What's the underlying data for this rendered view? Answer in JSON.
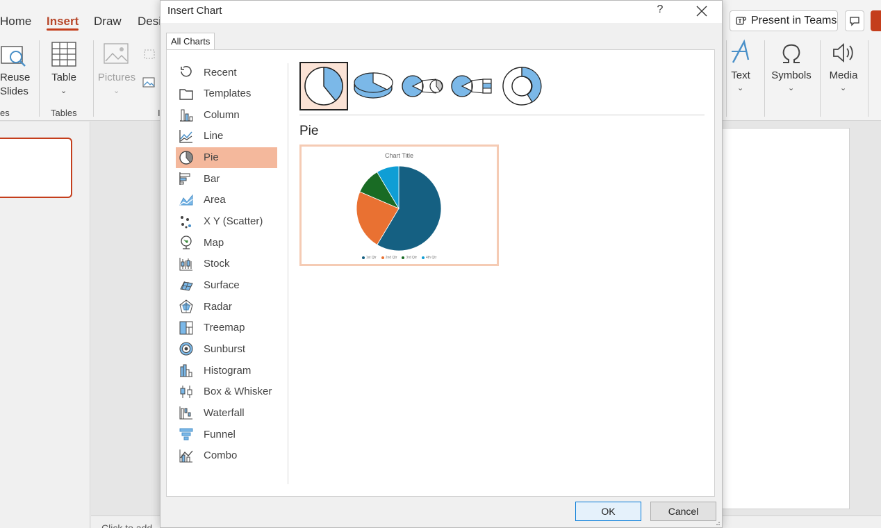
{
  "app": {
    "tabs": [
      "Home",
      "Insert",
      "Draw",
      "Desi"
    ],
    "active_tab": "Insert",
    "ribbon_left": {
      "reuse_slides": [
        "Reuse",
        "Slides"
      ],
      "group_left_partial": "es",
      "table_label": "Table",
      "tables_group": "Tables",
      "pictures_label": "Pictures",
      "group_partial": "I"
    },
    "ribbon_right": {
      "text_label": "Text",
      "symbols_label": "Symbols",
      "media_label": "Media"
    },
    "present_in_teams": "Present in Teams",
    "notes_placeholder": "Click to add"
  },
  "dialog": {
    "title": "Insert Chart",
    "help": "?",
    "tab": "All Charts",
    "categories": [
      {
        "label": "Recent",
        "icon": "recent-icon"
      },
      {
        "label": "Templates",
        "icon": "templates-icon"
      },
      {
        "label": "Column",
        "icon": "column-chart-icon"
      },
      {
        "label": "Line",
        "icon": "line-chart-icon"
      },
      {
        "label": "Pie",
        "icon": "pie-chart-icon"
      },
      {
        "label": "Bar",
        "icon": "bar-chart-icon"
      },
      {
        "label": "Area",
        "icon": "area-chart-icon"
      },
      {
        "label": "X Y (Scatter)",
        "icon": "scatter-chart-icon"
      },
      {
        "label": "Map",
        "icon": "map-chart-icon"
      },
      {
        "label": "Stock",
        "icon": "stock-chart-icon"
      },
      {
        "label": "Surface",
        "icon": "surface-chart-icon"
      },
      {
        "label": "Radar",
        "icon": "radar-chart-icon"
      },
      {
        "label": "Treemap",
        "icon": "treemap-chart-icon"
      },
      {
        "label": "Sunburst",
        "icon": "sunburst-chart-icon"
      },
      {
        "label": "Histogram",
        "icon": "histogram-chart-icon"
      },
      {
        "label": "Box & Whisker",
        "icon": "box-whisker-chart-icon"
      },
      {
        "label": "Waterfall",
        "icon": "waterfall-chart-icon"
      },
      {
        "label": "Funnel",
        "icon": "funnel-chart-icon"
      },
      {
        "label": "Combo",
        "icon": "combo-chart-icon"
      }
    ],
    "selected_category": "Pie",
    "subtypes": [
      "pie-subtype-icon",
      "pie-3d-subtype-icon",
      "pie-of-pie-subtype-icon",
      "bar-of-pie-subtype-icon",
      "doughnut-subtype-icon"
    ],
    "subtype_title": "Pie",
    "preview": {
      "title": "Chart Title",
      "legend": [
        "1st Qtr",
        "2nd Qtr",
        "3rd Qtr",
        "4th Qtr"
      ]
    },
    "ok": "OK",
    "cancel": "Cancel"
  },
  "chart_data": {
    "type": "pie",
    "title": "Chart Title",
    "categories": [
      "1st Qtr",
      "2nd Qtr",
      "3rd Qtr",
      "4th Qtr"
    ],
    "values": [
      8.2,
      3.2,
      1.4,
      1.2
    ],
    "colors": [
      "#156082",
      "#e97132",
      "#196b24",
      "#0f9ed5"
    ]
  },
  "colors": {
    "accent": "#c43e1c",
    "selected_category": "#f4b89c",
    "icon_blue": "#4a90c8"
  }
}
